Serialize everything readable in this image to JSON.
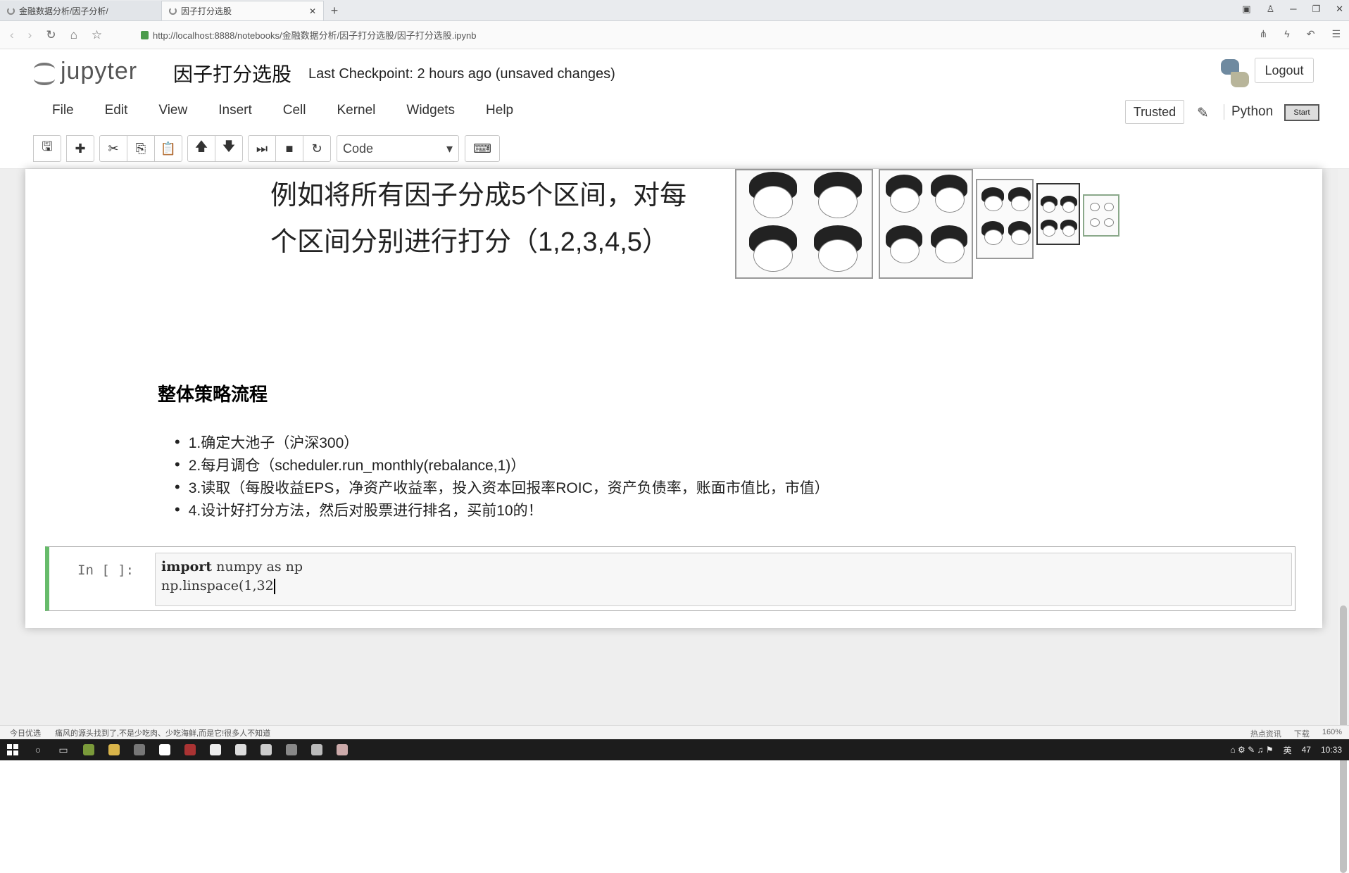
{
  "browser": {
    "tabs": [
      {
        "label": "金融数据分析/因子分析/"
      },
      {
        "label": "因子打分选股"
      }
    ],
    "new_tab": "+",
    "url": "http://localhost:8888/notebooks/金融数据分析/因子打分选股/因子打分选股.ipynb"
  },
  "jupyter": {
    "logo_text": "jupyter",
    "notebook_title": "因子打分选股",
    "checkpoint": "Last Checkpoint: 2 hours ago (unsaved changes)",
    "logout": "Logout",
    "menu": [
      "File",
      "Edit",
      "View",
      "Insert",
      "Cell",
      "Kernel",
      "Widgets",
      "Help"
    ],
    "trusted": "Trusted",
    "kernel": "Python",
    "start": "Start",
    "cell_type": "Code"
  },
  "notebook": {
    "slide_text_line1": "例如将所有因子分成5个区间，对每",
    "slide_text_line2": "个区间分别进行打分（1,2,3,4,5）",
    "heading": "整体策略流程",
    "steps": [
      "1.确定大池子（沪深300）",
      "2.每月调仓（scheduler.run_monthly(rebalance,1)）",
      "3.读取（每股收益EPS，净资产收益率，投入资本回报率ROIC，资产负债率，账面市值比，市值）",
      "4.设计好打分方法，然后对股票进行排名，买前10的！"
    ],
    "code_prompt": "In  [ ]:",
    "code_line1_kw": "import",
    "code_line1_rest": " numpy as np",
    "code_line2": "np.linspace(1,32"
  },
  "statusbar": {
    "left_label": "今日优选",
    "news": "痛风的源头找到了,不是少吃肉、少吃海鲜,而是它!很多人不知道",
    "right_items": [
      "热点资讯",
      "下载",
      "160%"
    ]
  },
  "taskbar": {
    "ime": "英",
    "badge": "47",
    "time": "10:33"
  }
}
